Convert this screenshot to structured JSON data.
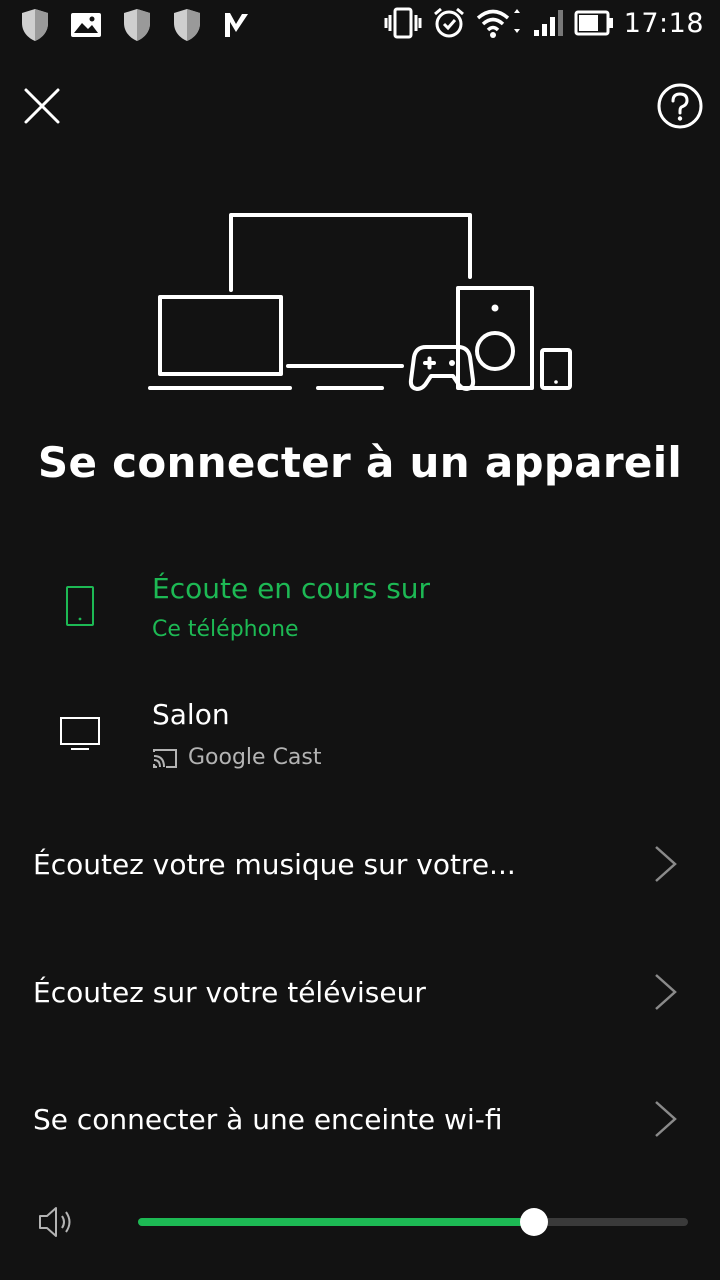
{
  "status_bar": {
    "time": "17:18",
    "left_icons": [
      "shield-icon",
      "image-notification-icon",
      "shield-icon",
      "shield-icon",
      "check-app-icon"
    ],
    "right_icons": [
      "vibrate-icon",
      "alarm-icon",
      "wifi-icon",
      "signal-icon",
      "battery-icon"
    ]
  },
  "header": {
    "close_icon": "close-icon",
    "help_icon": "help-icon"
  },
  "title": "Se connecter à un appareil",
  "devices": [
    {
      "icon": "phone-icon",
      "title": "Écoute en cours sur",
      "subtitle": "Ce téléphone",
      "active": true
    },
    {
      "icon": "tv-icon",
      "title": "Salon",
      "subtitle_icon": "cast-icon",
      "subtitle": "Google Cast",
      "active": false
    }
  ],
  "options": [
    {
      "label": "Écoutez votre musique sur votre..."
    },
    {
      "label": "Écoutez sur votre téléviseur"
    },
    {
      "label": "Se connecter à une enceinte wi-fi"
    }
  ],
  "volume": {
    "icon": "speaker-icon",
    "level": 0.72
  },
  "colors": {
    "background": "#121212",
    "accent": "#1db954",
    "text": "#ffffff",
    "subtext": "#b3b3b3"
  }
}
